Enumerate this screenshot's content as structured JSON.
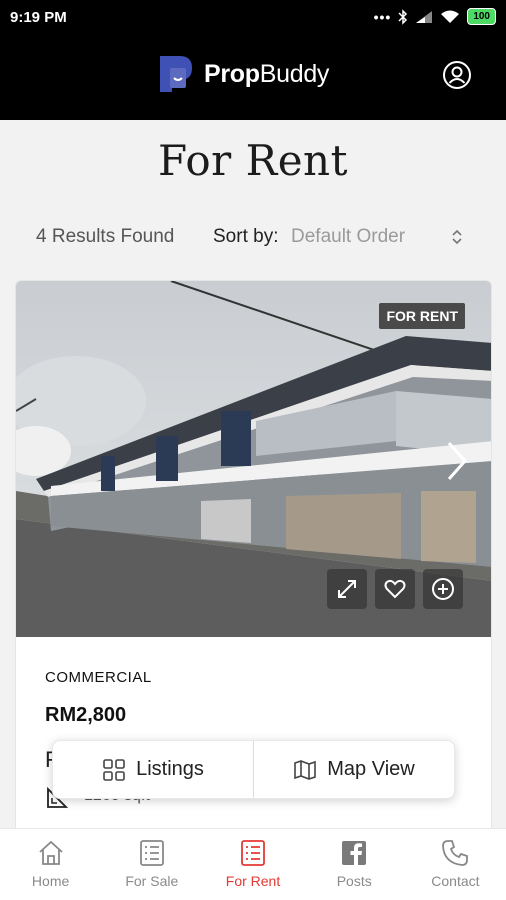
{
  "status_bar": {
    "time": "9:19 PM",
    "battery": "100"
  },
  "header": {
    "app_name_bold": "Prop",
    "app_name_light": "Buddy"
  },
  "page": {
    "title": "For Rent",
    "results": "4 Results Found",
    "sort_label": "Sort by:",
    "sort_value": "Default Order"
  },
  "listing": {
    "badge": "FOR RENT",
    "type": "COMMERCIAL",
    "price": "RM2,800",
    "partial_title": "F",
    "area_partial": "1260 sqft"
  },
  "view_toggle": {
    "listings_label": "Listings",
    "map_label": "Map View"
  },
  "nav": {
    "items": [
      {
        "label": "Home",
        "icon": "home-icon"
      },
      {
        "label": "For Sale",
        "icon": "list-icon"
      },
      {
        "label": "For Rent",
        "icon": "list-icon",
        "active": true
      },
      {
        "label": "Posts",
        "icon": "facebook-icon"
      },
      {
        "label": "Contact",
        "icon": "phone-icon"
      }
    ]
  },
  "colors": {
    "accent": "#e53935",
    "header_bg": "#000000",
    "badge_bg": "#4a4a4a",
    "logo": "#3f51b5"
  }
}
